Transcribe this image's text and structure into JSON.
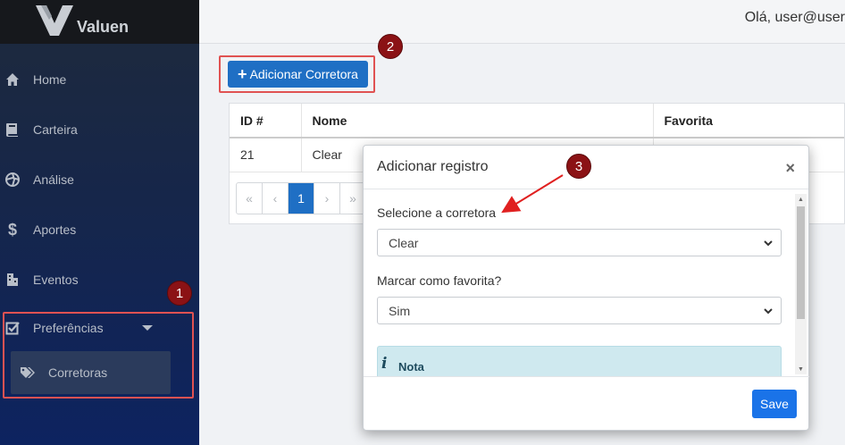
{
  "app": {
    "brand": "Valuen"
  },
  "header": {
    "greeting": "Olá, user@user"
  },
  "sidebar": {
    "items": [
      {
        "label": "Home",
        "icon": "home-icon"
      },
      {
        "label": "Carteira",
        "icon": "book-icon"
      },
      {
        "label": "Análise",
        "icon": "aperture-icon"
      },
      {
        "label": "Aportes",
        "icon": "dollar-icon"
      },
      {
        "label": "Eventos",
        "icon": "building-icon"
      },
      {
        "label": "Preferências",
        "icon": "checkbox-edit-icon"
      }
    ],
    "sub_items": [
      {
        "label": "Corretoras",
        "icon": "tags-icon"
      }
    ]
  },
  "toolbar": {
    "add_label": "Adicionar Corretora"
  },
  "table": {
    "headers": [
      "ID #",
      "Nome",
      "Favorita"
    ],
    "rows": [
      {
        "id": "21",
        "nome": "Clear",
        "favorita": ""
      }
    ]
  },
  "pagination": {
    "first": "«",
    "prev": "‹",
    "current": "1",
    "next": "›",
    "last": "»"
  },
  "modal": {
    "title": "Adicionar registro",
    "close": "×",
    "broker_label": "Selecione a corretora",
    "broker_value": "Clear",
    "favorite_label": "Marcar como favorita?",
    "favorite_value": "Sim",
    "note_title": "Nota",
    "note_icon": "i",
    "save_label": "Save"
  },
  "annotations": [
    "1",
    "2",
    "3"
  ],
  "colors": {
    "primary": "#1f6fc4",
    "annotation": "#e05252",
    "badge": "#8b1215"
  }
}
